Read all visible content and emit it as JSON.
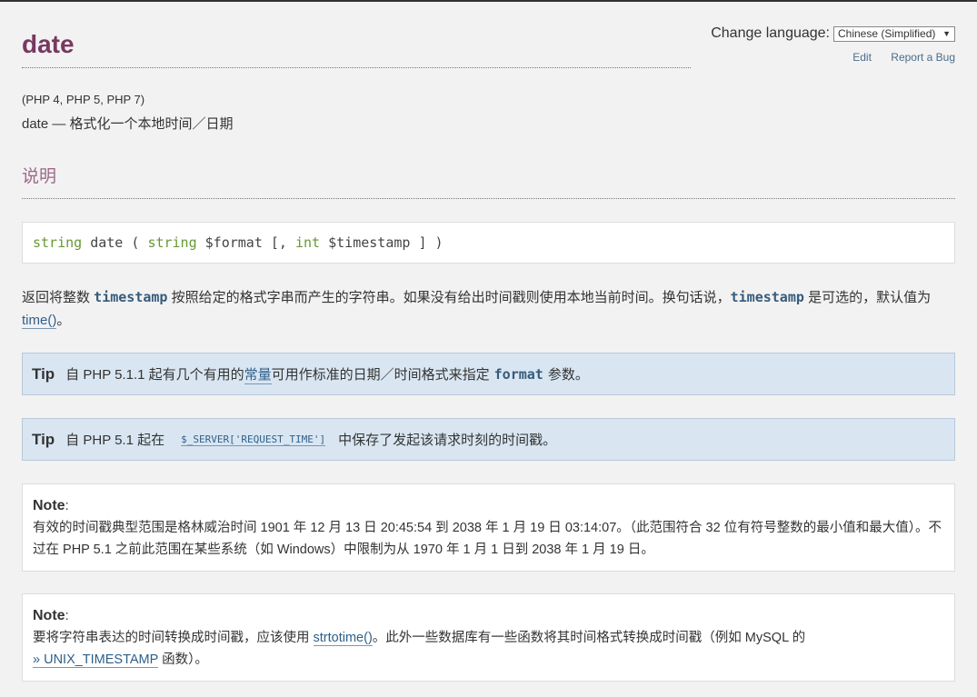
{
  "header": {
    "title": "date"
  },
  "language": {
    "label": "Change language:",
    "selected": "Chinese (Simplified)",
    "edit": "Edit",
    "report_bug": "Report a Bug"
  },
  "versions": "(PHP 4, PHP 5, PHP 7)",
  "refname": {
    "name": "date",
    "dash": " — ",
    "purpose": "格式化一个本地时间／日期"
  },
  "section": {
    "title": "说明"
  },
  "synopsis": {
    "return_type": "string",
    "name": "date",
    "open": " ( ",
    "p1_type": "string",
    "p1_name": "$format",
    "opt_open": " [, ",
    "p2_type": "int",
    "p2_name": "$timestamp",
    "close": " ] )"
  },
  "description": {
    "t1": "返回将整数 ",
    "kw1": "timestamp",
    "t2": " 按照给定的格式字串而产生的字符串。如果没有给出时间戳则使用本地当前时间。换句话说，",
    "kw2": "timestamp",
    "t3": " 是可选的，默认值为 ",
    "link": "time()",
    "t4": "。"
  },
  "tip1": {
    "label": "Tip",
    "t1": "自 PHP 5.1.1 起有几个有用的",
    "link": "常量",
    "t2": "可用作标准的日期／时间格式来指定",
    "kw": "format",
    "t3": "参数。"
  },
  "tip2": {
    "label": "Tip",
    "t1": "自 PHP 5.1 起在",
    "code": "$_SERVER['REQUEST_TIME']",
    "t2": "中保存了发起该请求时刻的时间戳。"
  },
  "note1": {
    "label": "Note",
    "colon": ":",
    "text": "有效的时间戳典型范围是格林威治时间 1901 年 12 月 13 日 20:45:54 到 2038 年 1 月 19 日 03:14:07。（此范围符合 32 位有符号整数的最小值和最大值）。不过在 PHP 5.1 之前此范围在某些系统（如 Windows）中限制为从 1970 年 1 月 1 日到 2038 年 1 月 19 日。"
  },
  "note2": {
    "label": "Note",
    "colon": ":",
    "t1": "要将字符串表达的时间转换成时间戳，应该使用 ",
    "link1": "strtotime()",
    "t2": "。此外一些数据库有一些函数将其时间格式转换成时间戳（例如 MySQL 的",
    "link2": "» UNIX_TIMESTAMP",
    "t3": " 函数）。"
  }
}
